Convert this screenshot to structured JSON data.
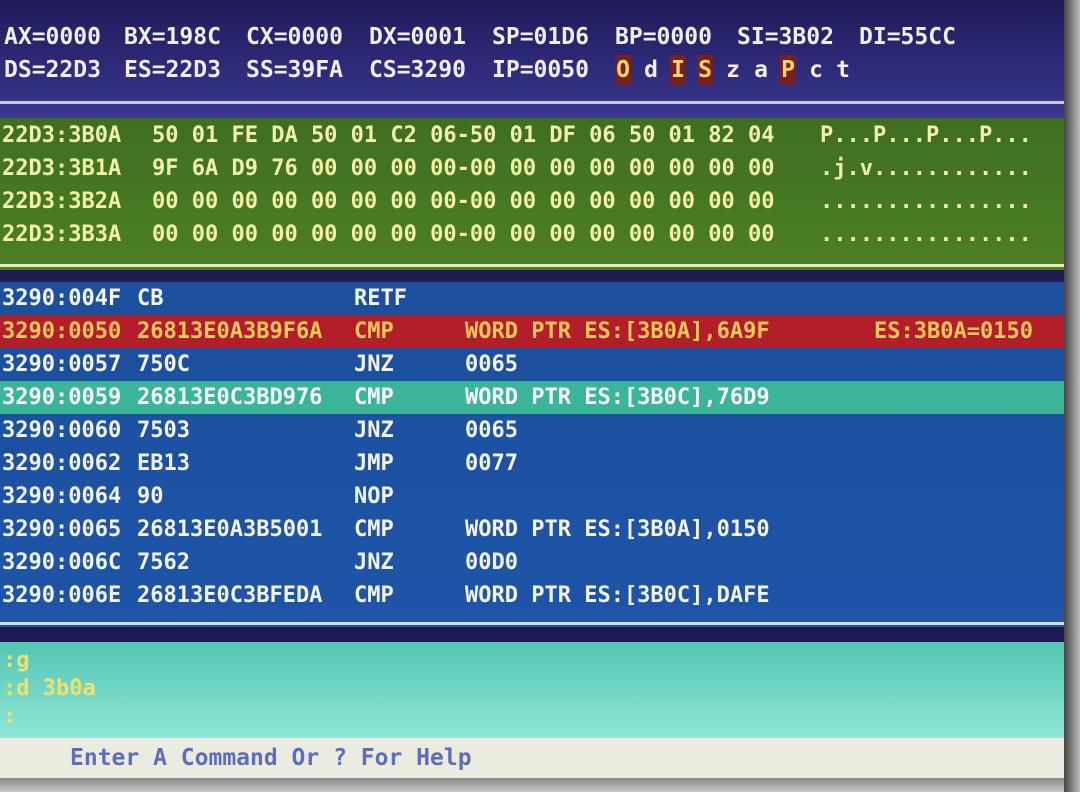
{
  "registers": {
    "row1": [
      "AX=0000",
      "BX=198C",
      "CX=0000",
      "DX=0001",
      "SP=01D6",
      "BP=0000",
      "SI=3B02",
      "DI=55CC"
    ],
    "row2": [
      "DS=22D3",
      "ES=22D3",
      "SS=39FA",
      "CS=3290",
      "IP=0050"
    ],
    "flags": [
      {
        "label": "O",
        "active": true
      },
      {
        "label": "d",
        "active": false
      },
      {
        "label": "I",
        "active": true
      },
      {
        "label": "S",
        "active": true
      },
      {
        "label": "z",
        "active": false
      },
      {
        "label": "a",
        "active": false
      },
      {
        "label": "P",
        "active": true
      },
      {
        "label": "c",
        "active": false
      },
      {
        "label": "t",
        "active": false
      }
    ]
  },
  "dump": [
    {
      "addr": "22D3:3B0A",
      "bytes": "50 01 FE DA 50 01 C2 06-50 01 DF 06 50 01 82 04",
      "ascii": "P...P...P...P..."
    },
    {
      "addr": "22D3:3B1A",
      "bytes": "9F 6A D9 76 00 00 00 00-00 00 00 00 00 00 00 00",
      "ascii": ".j.v............"
    },
    {
      "addr": "22D3:3B2A",
      "bytes": "00 00 00 00 00 00 00 00-00 00 00 00 00 00 00 00",
      "ascii": "................"
    },
    {
      "addr": "22D3:3B3A",
      "bytes": "00 00 00 00 00 00 00 00-00 00 00 00 00 00 00 00",
      "ascii": "................"
    }
  ],
  "code": [
    {
      "addr": "3290:004F",
      "hex": "CB",
      "mnemonic": "RETF",
      "operand": "",
      "note": "",
      "state": ""
    },
    {
      "addr": "3290:0050",
      "hex": "26813E0A3B9F6A",
      "mnemonic": "CMP",
      "operand": "WORD PTR ES:[3B0A],6A9F",
      "note": "ES:3B0A=0150",
      "state": "current"
    },
    {
      "addr": "3290:0057",
      "hex": "750C",
      "mnemonic": "JNZ",
      "operand": "0065",
      "note": "",
      "state": ""
    },
    {
      "addr": "3290:0059",
      "hex": "26813E0C3BD976",
      "mnemonic": "CMP",
      "operand": "WORD PTR ES:[3B0C],76D9",
      "note": "",
      "state": "cursor"
    },
    {
      "addr": "3290:0060",
      "hex": "7503",
      "mnemonic": "JNZ",
      "operand": "0065",
      "note": "",
      "state": ""
    },
    {
      "addr": "3290:0062",
      "hex": "EB13",
      "mnemonic": "JMP",
      "operand": "0077",
      "note": "",
      "state": ""
    },
    {
      "addr": "3290:0064",
      "hex": "90",
      "mnemonic": "NOP",
      "operand": "",
      "note": "",
      "state": ""
    },
    {
      "addr": "3290:0065",
      "hex": "26813E0A3B5001",
      "mnemonic": "CMP",
      "operand": "WORD PTR ES:[3B0A],0150",
      "note": "",
      "state": ""
    },
    {
      "addr": "3290:006C",
      "hex": "7562",
      "mnemonic": "JNZ",
      "operand": "00D0",
      "note": "",
      "state": ""
    },
    {
      "addr": "3290:006E",
      "hex": "26813E0C3BFEDA",
      "mnemonic": "CMP",
      "operand": "WORD PTR ES:[3B0C],DAFE",
      "note": "",
      "state": ""
    }
  ],
  "commands": [
    ":g",
    ":d 3b0a",
    ":"
  ],
  "status_text": "Enter A Command Or ? For Help",
  "colors": {
    "register_bg": "#2d2a78",
    "dump_bg": "#4d7f25",
    "code_bg": "#1e55a8",
    "current_line": "#b21e2a",
    "cursor_line": "#3bb59a",
    "command_bg": "#8fe6d8",
    "flag_active": "#7a1f1f"
  }
}
